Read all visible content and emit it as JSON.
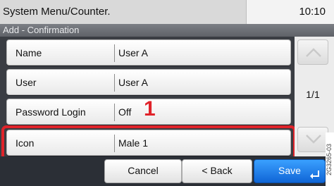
{
  "topbar": {
    "title": "System Menu/Counter.",
    "time": "10:10"
  },
  "subheader": {
    "title": "Add - Confirmation"
  },
  "rows": [
    {
      "label": "Name",
      "value": "User A"
    },
    {
      "label": "User",
      "value": "User A"
    },
    {
      "label": "Password Login",
      "value": "Off"
    },
    {
      "label": "Icon",
      "value": "Male 1"
    }
  ],
  "callout": {
    "number": "1"
  },
  "pager": {
    "indicator": "1/1"
  },
  "buttons": {
    "cancel": "Cancel",
    "back": "< Back",
    "save": "Save"
  },
  "side_code": "2G3265-03",
  "colors": {
    "highlight": "#e0232a",
    "save_button": "#1065d6"
  }
}
